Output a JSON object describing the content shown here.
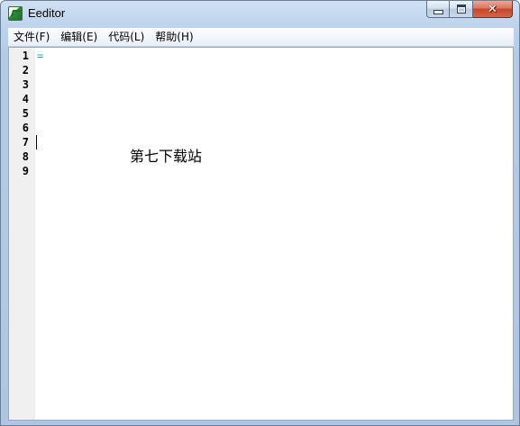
{
  "window": {
    "title": "Eeditor",
    "icon": "app-icon",
    "controls": {
      "minimize": "minimize-icon",
      "maximize": "maximize-icon",
      "close_glyph": "✕"
    }
  },
  "menubar": {
    "items": [
      {
        "label": "文件(F)"
      },
      {
        "label": "编辑(E)"
      },
      {
        "label": "代码(L)"
      },
      {
        "label": "帮助(H)"
      }
    ]
  },
  "editor": {
    "line_numbers": [
      "1",
      "2",
      "3",
      "4",
      "5",
      "6",
      "7",
      "8",
      "9"
    ],
    "lines": [
      "=",
      "",
      "",
      "",
      "",
      "",
      "",
      "",
      ""
    ],
    "caret_line": 7,
    "watermark": "第七下载站"
  },
  "colors": {
    "operator": "#1aa0c8",
    "gutter_bg": "#f0f0f0"
  }
}
